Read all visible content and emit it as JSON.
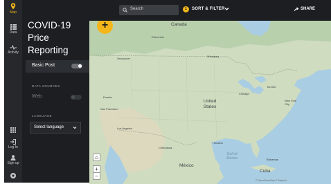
{
  "app": {
    "title": "COVID-19 Price Reporting"
  },
  "rail": {
    "items": [
      {
        "label": "Map",
        "icon": "map-pin-icon",
        "active": true
      },
      {
        "label": "Data",
        "icon": "data-grid-icon",
        "active": false
      },
      {
        "label": "Activity",
        "icon": "activity-icon",
        "active": false
      }
    ],
    "bottom": [
      {
        "label": "",
        "icon": "apps-grid-icon"
      },
      {
        "label": "Log In",
        "icon": "login-icon"
      },
      {
        "label": "Sign up",
        "icon": "user-icon"
      },
      {
        "label": "",
        "icon": "settings-icon"
      }
    ]
  },
  "panel": {
    "post_label": "Basic Post",
    "data_sources_heading": "DATA SOURCES",
    "web_label": "Web",
    "language_heading": "LANGUAGE",
    "language_value": "Select language"
  },
  "topbar": {
    "search_placeholder": "Search",
    "filter_count": "1",
    "filter_label": "SORT & FILTER",
    "share_label": "SHARE"
  },
  "map": {
    "add_label": "+",
    "home_label": "⌂",
    "zoom_in": "+",
    "zoom_out": "−",
    "labels": {
      "canada": "Canada",
      "edmonton": "Edmonton",
      "vancouver": "Vancouver",
      "winnipeg": "Winnipeg",
      "toronto": "Toronto",
      "chicago": "Chicago",
      "new_york": "New York City",
      "united_states": "United States",
      "eureka": "Eureka",
      "san_francisco": "San Francisco",
      "los_angeles": "Los Angeles",
      "chihuahua": "Chihuahua",
      "houston": "Houston",
      "mexico": "México",
      "gulf": "Gulf of Mexico",
      "bahamas": "Bahamas",
      "cuba": "Cuba",
      "attribution": "© OpenStreetMap © Mapbox"
    }
  },
  "colors": {
    "accent": "#f2b61b",
    "sidebar": "#1c1e21",
    "water": "#a9cde3"
  }
}
